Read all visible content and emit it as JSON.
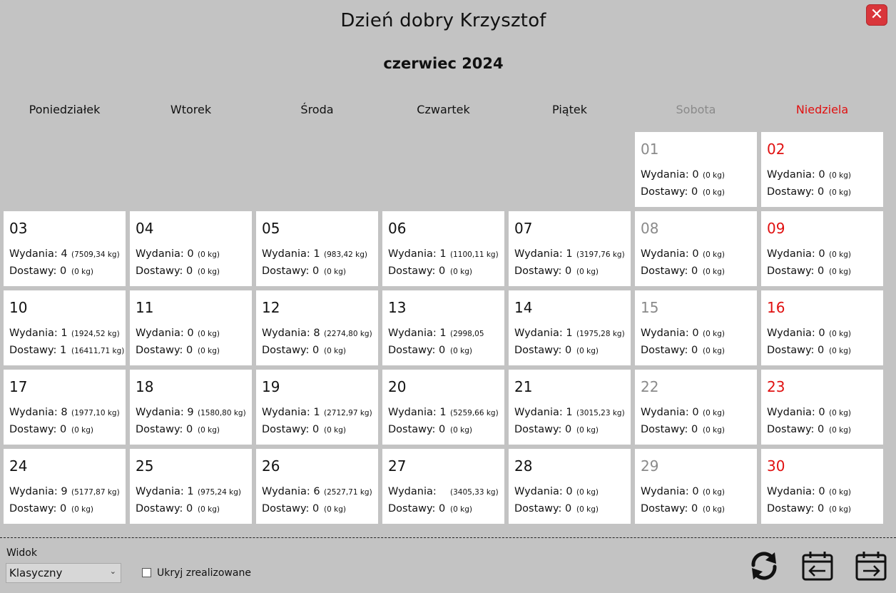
{
  "header": {
    "greeting": "Dzień dobry Krzysztof",
    "month": "czerwiec 2024",
    "close_label": "✕"
  },
  "weekdays": [
    "Poniedziałek",
    "Wtorek",
    "Środa",
    "Czwartek",
    "Piątek",
    "Sobota",
    "Niedziela"
  ],
  "labels": {
    "issues": "Wydania:",
    "deliveries": "Dostawy:"
  },
  "colors": {
    "saturday": "#8a8a8a",
    "sunday": "#e01010",
    "close": "#d9363b"
  },
  "days": [
    {
      "day": "01",
      "issues": "0",
      "issues_kg": "(0 kg)",
      "deliveries": "0",
      "deliveries_kg": "(0 kg)"
    },
    {
      "day": "02",
      "issues": "0",
      "issues_kg": "(0 kg)",
      "deliveries": "0",
      "deliveries_kg": "(0 kg)"
    },
    {
      "day": "03",
      "issues": "4",
      "issues_kg": "(7509,34 kg)",
      "deliveries": "0",
      "deliveries_kg": "(0 kg)"
    },
    {
      "day": "04",
      "issues": "0",
      "issues_kg": "(0 kg)",
      "deliveries": "0",
      "deliveries_kg": "(0 kg)"
    },
    {
      "day": "05",
      "issues": "1",
      "issues_kg": "(983,42 kg)",
      "deliveries": "0",
      "deliveries_kg": "(0 kg)"
    },
    {
      "day": "06",
      "issues": "1",
      "issues_kg": "(1100,11 kg)",
      "deliveries": "0",
      "deliveries_kg": "(0 kg)"
    },
    {
      "day": "07",
      "issues": "1",
      "issues_kg": "(3197,76 kg)",
      "deliveries": "0",
      "deliveries_kg": "(0 kg)"
    },
    {
      "day": "08",
      "issues": "0",
      "issues_kg": "(0 kg)",
      "deliveries": "0",
      "deliveries_kg": "(0 kg)"
    },
    {
      "day": "09",
      "issues": "0",
      "issues_kg": "(0 kg)",
      "deliveries": "0",
      "deliveries_kg": "(0 kg)"
    },
    {
      "day": "10",
      "issues": "1",
      "issues_kg": "(1924,52 kg)",
      "deliveries": "1",
      "deliveries_kg": "(16411,71 kg)"
    },
    {
      "day": "11",
      "issues": "0",
      "issues_kg": "(0 kg)",
      "deliveries": "0",
      "deliveries_kg": "(0 kg)"
    },
    {
      "day": "12",
      "issues": "8",
      "issues_kg": "(2274,80 kg)",
      "deliveries": "0",
      "deliveries_kg": "(0 kg)"
    },
    {
      "day": "13",
      "issues": "1",
      "issues_kg": "(2998,05",
      "deliveries": "0",
      "deliveries_kg": "(0 kg)"
    },
    {
      "day": "14",
      "issues": "1",
      "issues_kg": "(1975,28 kg)",
      "deliveries": "0",
      "deliveries_kg": "(0 kg)"
    },
    {
      "day": "15",
      "issues": "0",
      "issues_kg": "(0 kg)",
      "deliveries": "0",
      "deliveries_kg": "(0 kg)"
    },
    {
      "day": "16",
      "issues": "0",
      "issues_kg": "(0 kg)",
      "deliveries": "0",
      "deliveries_kg": "(0 kg)"
    },
    {
      "day": "17",
      "issues": "8",
      "issues_kg": "(1977,10 kg)",
      "deliveries": "0",
      "deliveries_kg": "(0 kg)"
    },
    {
      "day": "18",
      "issues": "9",
      "issues_kg": "(1580,80 kg)",
      "deliveries": "0",
      "deliveries_kg": "(0 kg)"
    },
    {
      "day": "19",
      "issues": "1",
      "issues_kg": "(2712,97 kg)",
      "deliveries": "0",
      "deliveries_kg": "(0 kg)"
    },
    {
      "day": "20",
      "issues": "1",
      "issues_kg": "(5259,66 kg)",
      "deliveries": "0",
      "deliveries_kg": "(0 kg)"
    },
    {
      "day": "21",
      "issues": "1",
      "issues_kg": "(3015,23 kg)",
      "deliveries": "0",
      "deliveries_kg": "(0 kg)"
    },
    {
      "day": "22",
      "issues": "0",
      "issues_kg": "(0 kg)",
      "deliveries": "0",
      "deliveries_kg": "(0 kg)"
    },
    {
      "day": "23",
      "issues": "0",
      "issues_kg": "(0 kg)",
      "deliveries": "0",
      "deliveries_kg": "(0 kg)"
    },
    {
      "day": "24",
      "issues": "9",
      "issues_kg": "(5177,87 kg)",
      "deliveries": "0",
      "deliveries_kg": "(0 kg)"
    },
    {
      "day": "25",
      "issues": "1",
      "issues_kg": "(975,24 kg)",
      "deliveries": "0",
      "deliveries_kg": "(0 kg)"
    },
    {
      "day": "26",
      "issues": "6",
      "issues_kg": "(2527,71 kg)",
      "deliveries": "0",
      "deliveries_kg": "(0 kg)"
    },
    {
      "day": "27",
      "issues": "",
      "issues_kg": "(3405,33 kg)",
      "deliveries": "0",
      "deliveries_kg": "(0 kg)"
    },
    {
      "day": "28",
      "issues": "0",
      "issues_kg": "(0 kg)",
      "deliveries": "0",
      "deliveries_kg": "(0 kg)"
    },
    {
      "day": "29",
      "issues": "0",
      "issues_kg": "(0 kg)",
      "deliveries": "0",
      "deliveries_kg": "(0 kg)"
    },
    {
      "day": "30",
      "issues": "0",
      "issues_kg": "(0 kg)",
      "deliveries": "0",
      "deliveries_kg": "(0 kg)"
    }
  ],
  "footer": {
    "view_label": "Widok",
    "view_selected": "Klasyczny",
    "hide_label": "Ukryj zrealizowane",
    "hide_checked": false,
    "icons": [
      "refresh-icon",
      "previous-month-icon",
      "next-month-icon"
    ]
  }
}
